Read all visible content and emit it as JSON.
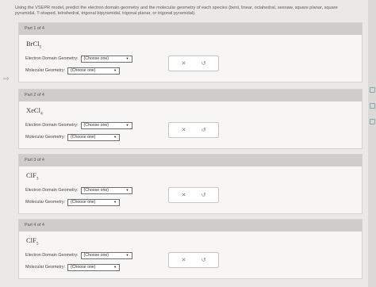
{
  "instructions": "Using the VSEPR model, predict the electron domain geometry and the molecular geometry of each species (bent, linear, octahedral, seesaw, square planar, square pyramidal, T-shaped, tetrahedral, trigonal bipyramidal, trigonal planar, or trigonal pyramidal).",
  "labels": {
    "electron_domain": "Electron Domain Geometry:",
    "molecular": "Molecular Geometry:"
  },
  "select_placeholder": "(Choose one)",
  "caret_glyph": "▼",
  "icons": {
    "clear": "✕",
    "undo": "↺"
  },
  "parts": [
    {
      "header": "Part 1 of 4",
      "formula": "BrCl",
      "sub": "5"
    },
    {
      "header": "Part 2 of 4",
      "formula": "XeCl",
      "sub": "4"
    },
    {
      "header": "Part 3 of 4",
      "formula": "ClF",
      "sub": "3"
    },
    {
      "header": "Part 4 of 4",
      "formula": "ClF",
      "sub": "5"
    }
  ]
}
